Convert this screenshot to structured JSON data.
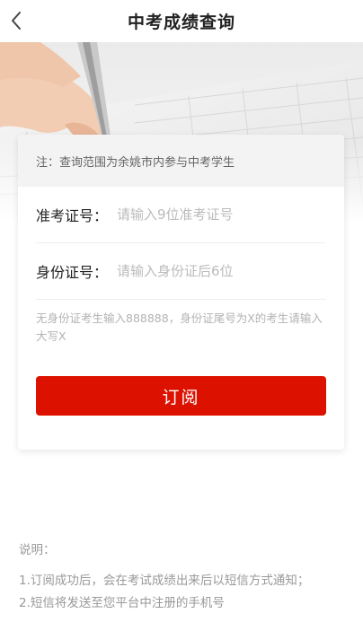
{
  "header": {
    "title": "中考成绩查询",
    "back_icon": "chevron-left-icon"
  },
  "notice": {
    "text": "注：查询范围为余姚市内参与中考学生"
  },
  "form": {
    "exam_id": {
      "label": "准考证号：",
      "placeholder": "请输入9位准考证号",
      "value": ""
    },
    "id_card": {
      "label": "身份证号：",
      "placeholder": "请输入身份证后6位",
      "value": ""
    },
    "hint": "无身份证考生输入888888，身份证尾号为X的考生请输入大写X",
    "submit_label": "订阅"
  },
  "notes": {
    "title": "说明：",
    "lines": [
      "1.订阅成功后，会在考试成绩出来后以短信方式通知；",
      "2.短信将发送至您平台中注册的手机号"
    ]
  },
  "colors": {
    "accent": "#dd1100",
    "notice_bg": "#f3f3f3",
    "placeholder": "#bbbbbb",
    "muted_text": "#999999"
  }
}
